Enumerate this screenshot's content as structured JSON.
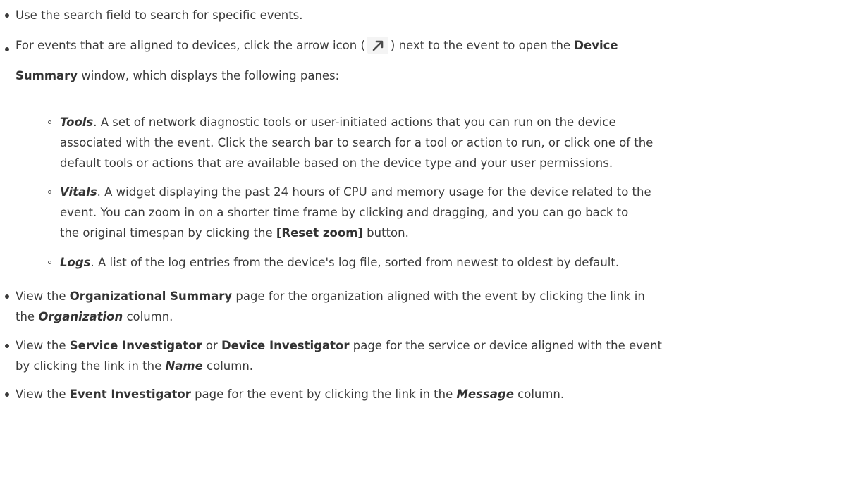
{
  "bullets": {
    "search": "Use the search field to search for specific events.",
    "arrow": {
      "pre": "For events that are aligned to devices, click the arrow icon (",
      "icon": "arrow-up-right-icon",
      "mid": ") next to the event to open the ",
      "bold1": "Device",
      "bold2": "Summary",
      "post": " window, which displays the following panes:"
    },
    "org": {
      "pre": "View the ",
      "bold": "Organizational Summary",
      "mid": " page for the organization aligned with the event by clicking the link in",
      "pre2": "the ",
      "italic": "Organization",
      "post": " column."
    },
    "service": {
      "pre": "View the ",
      "bold1": "Service Investigator",
      "or": " or ",
      "bold2": "Device Investigator",
      "mid": " page for the service or device aligned with the event",
      "pre2": "by clicking the link in the ",
      "italic": "Name",
      "post": " column."
    },
    "event": {
      "pre": "View the ",
      "bold": "Event Investigator",
      "mid": " page for the event by clicking the link in the ",
      "italic": "Message",
      "post": " column."
    }
  },
  "panes": {
    "tools": {
      "term": "Tools",
      "line1": ". A set of network diagnostic tools or user-initiated actions that you can run on the device",
      "line2": "associated with the event. Click the search bar to search for a tool or action to run, or click one of the",
      "line3": "default tools or actions that are available based on the device type and your user permissions."
    },
    "vitals": {
      "term": "Vitals",
      "line1": ". A widget displaying the past 24 hours of CPU and memory usage for the device related to the",
      "line2": "event. You can zoom in on a shorter time frame by clicking and dragging, and you can go back to",
      "line3pre": "the original timespan by clicking the ",
      "button": "[Reset zoom]",
      "line3post": " button."
    },
    "logs": {
      "term": "Logs",
      "line1": ". A list of the log entries from the device's log file, sorted from newest to oldest by default."
    }
  }
}
